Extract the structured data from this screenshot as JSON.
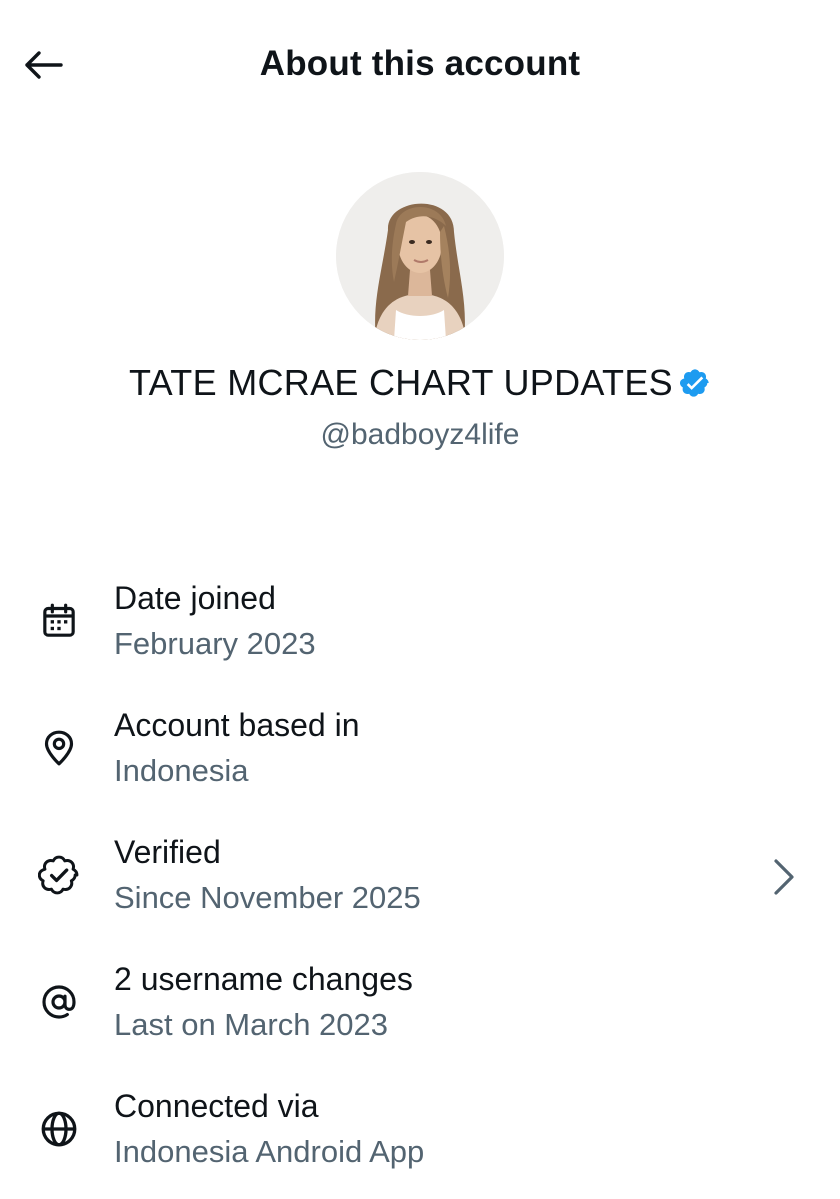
{
  "header": {
    "title": "About this account"
  },
  "profile": {
    "display_name": "TATE MCRAE CHART UPDATES",
    "handle": "@badboyz4life",
    "verified_color": "#1d9bf0"
  },
  "info_items": [
    {
      "icon": "calendar-icon",
      "label": "Date joined",
      "value": "February 2023"
    },
    {
      "icon": "location-pin-icon",
      "label": "Account based in",
      "value": "Indonesia"
    },
    {
      "icon": "verified-badge-icon",
      "label": "Verified",
      "value": "Since November 2025"
    },
    {
      "icon": "at-sign-icon",
      "label": "2 username changes",
      "value": "Last on March 2023"
    },
    {
      "icon": "globe-icon",
      "label": "Connected via",
      "value": "Indonesia Android App"
    }
  ],
  "colors": {
    "text_primary": "#0f1419",
    "text_secondary": "#536471",
    "accent": "#1d9bf0"
  }
}
